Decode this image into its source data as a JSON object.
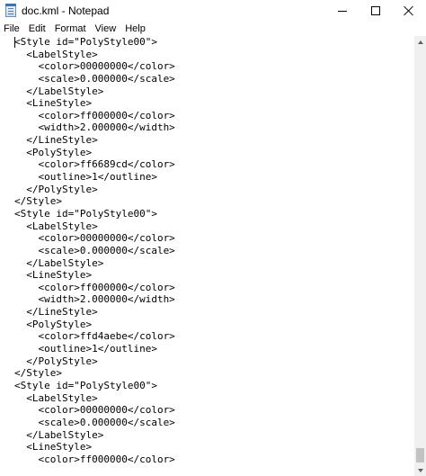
{
  "window": {
    "title": "doc.kml - Notepad",
    "icon": "notepad-icon"
  },
  "menu": [
    {
      "label": "File",
      "name": "menu-file"
    },
    {
      "label": "Edit",
      "name": "menu-edit"
    },
    {
      "label": "Format",
      "name": "menu-format"
    },
    {
      "label": "View",
      "name": "menu-view"
    },
    {
      "label": "Help",
      "name": "menu-help"
    }
  ],
  "document": {
    "lines": [
      "<Style id=\"PolyStyle00\">",
      "  <LabelStyle>",
      "    <color>00000000</color>",
      "    <scale>0.000000</scale>",
      "  </LabelStyle>",
      "  <LineStyle>",
      "    <color>ff000000</color>",
      "    <width>2.000000</width>",
      "  </LineStyle>",
      "  <PolyStyle>",
      "    <color>ff6689cd</color>",
      "    <outline>1</outline>",
      "  </PolyStyle>",
      "</Style>",
      "<Style id=\"PolyStyle00\">",
      "  <LabelStyle>",
      "    <color>00000000</color>",
      "    <scale>0.000000</scale>",
      "  </LabelStyle>",
      "  <LineStyle>",
      "    <color>ff000000</color>",
      "    <width>2.000000</width>",
      "  </LineStyle>",
      "  <PolyStyle>",
      "    <color>ffd4aebe</color>",
      "    <outline>1</outline>",
      "  </PolyStyle>",
      "</Style>",
      "<Style id=\"PolyStyle00\">",
      "  <LabelStyle>",
      "    <color>00000000</color>",
      "    <scale>0.000000</scale>",
      "  </LabelStyle>",
      "  <LineStyle>",
      "    <color>ff000000</color>"
    ]
  },
  "scrollbar": {
    "position_fraction": 0.97
  }
}
